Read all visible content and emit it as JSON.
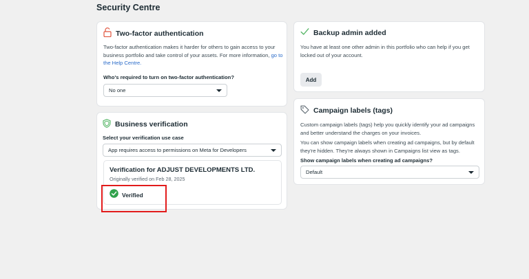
{
  "page": {
    "title": "Security Centre"
  },
  "two_factor": {
    "title": "Two-factor authentication",
    "description": "Two-factor authentication makes it harder for others to gain access to your business portfolio and take control of your assets. For more information,",
    "link_text": "go to the Help Centre.",
    "question": "Who's required to turn on two-factor authentication?",
    "selected": "No one"
  },
  "backup_admin": {
    "title": "Backup admin added",
    "description": "You have at least one other admin in this portfolio who can help if you get locked out of your account.",
    "add_label": "Add"
  },
  "business_verification": {
    "title": "Business verification",
    "use_case_label": "Select your verification use case",
    "use_case_selected": "App requires access to permissions on Meta for Developers",
    "verification_title": "Verification for ADJUST DEVELOPMENTS LTD.",
    "verified_date": "Originally verified on Feb 28, 2025",
    "status": "Verified"
  },
  "campaign_labels": {
    "title": "Campaign labels (tags)",
    "description_1": "Custom campaign labels (tags) help you quickly identify your ad campaigns and better understand the charges on your invoices.",
    "description_2": "You can show campaign labels when creating ad campaigns, but by default they're hidden. They're always shown in Campaigns list view as tags.",
    "question": "Show campaign labels when creating ad campaigns?",
    "selected": "Default"
  },
  "colors": {
    "lock_icon": "#e0533d",
    "check_icon": "#52b463",
    "verified_badge": "#31a24c",
    "highlight": "#e21b1b",
    "link": "#2a6bc9"
  }
}
